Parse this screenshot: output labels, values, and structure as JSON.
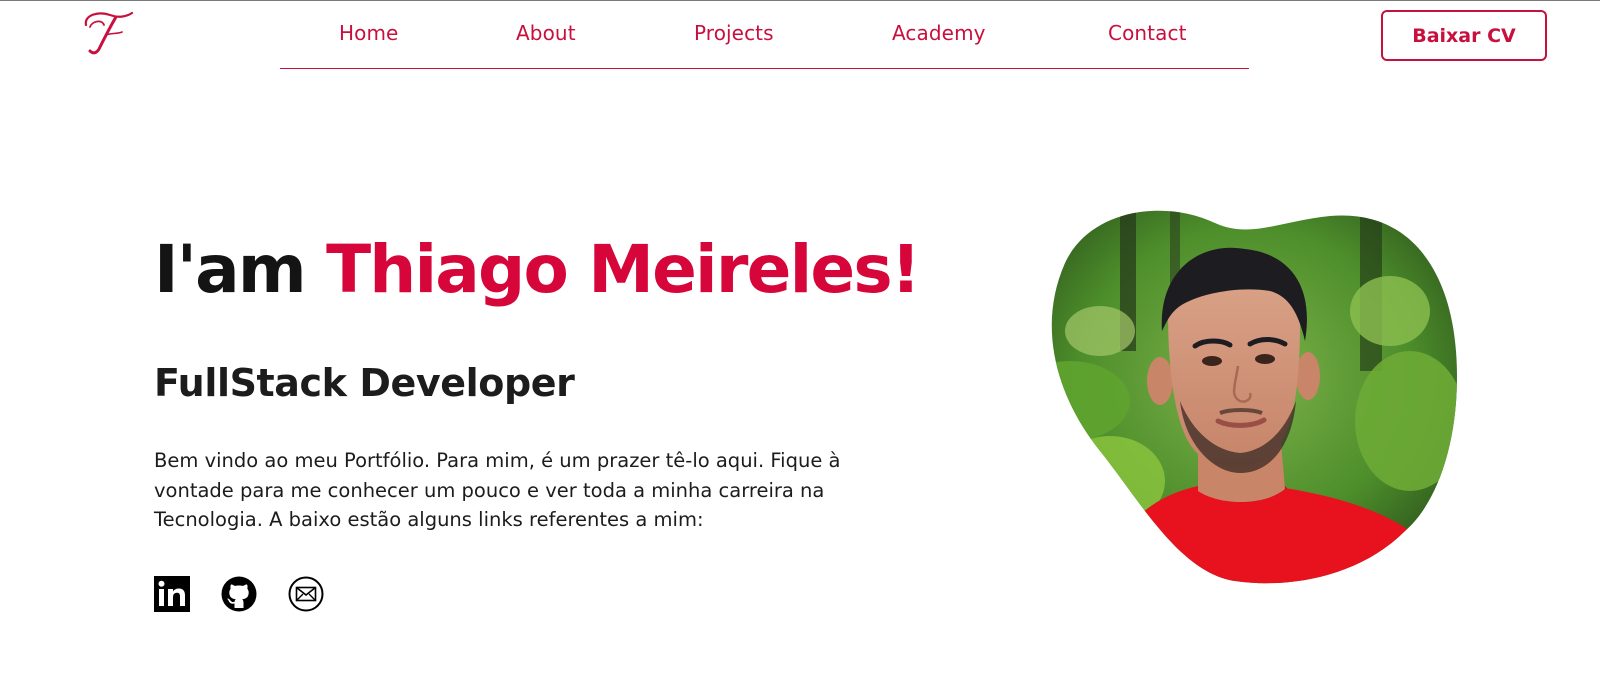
{
  "header": {
    "logo_icon": "cursive-t-logo-icon",
    "nav": [
      {
        "label": "Home"
      },
      {
        "label": "About"
      },
      {
        "label": "Projects"
      },
      {
        "label": "Academy"
      },
      {
        "label": "Contact"
      }
    ],
    "cv_button_label": "Baixar CV"
  },
  "hero": {
    "greeting": "I'am",
    "name": "Thiago Meireles!",
    "role": "FullStack Developer",
    "intro": "Bem vindo ao meu Portfólio. Para mim, é um prazer tê-lo aqui. Fique à vontade para me conhecer um pouco e ver toda a minha carreira na Tecnologia. A baixo estão alguns links referentes a mim:",
    "socials": [
      {
        "icon": "linkedin-icon"
      },
      {
        "icon": "github-icon"
      },
      {
        "icon": "email-icon"
      }
    ],
    "portrait_icon": "profile-photo"
  },
  "colors": {
    "accent": "#d6063b",
    "nav_text": "#c8103e",
    "text": "#1c1c1c",
    "shirt": "#e8121f",
    "foliage": "#3f8a22"
  }
}
